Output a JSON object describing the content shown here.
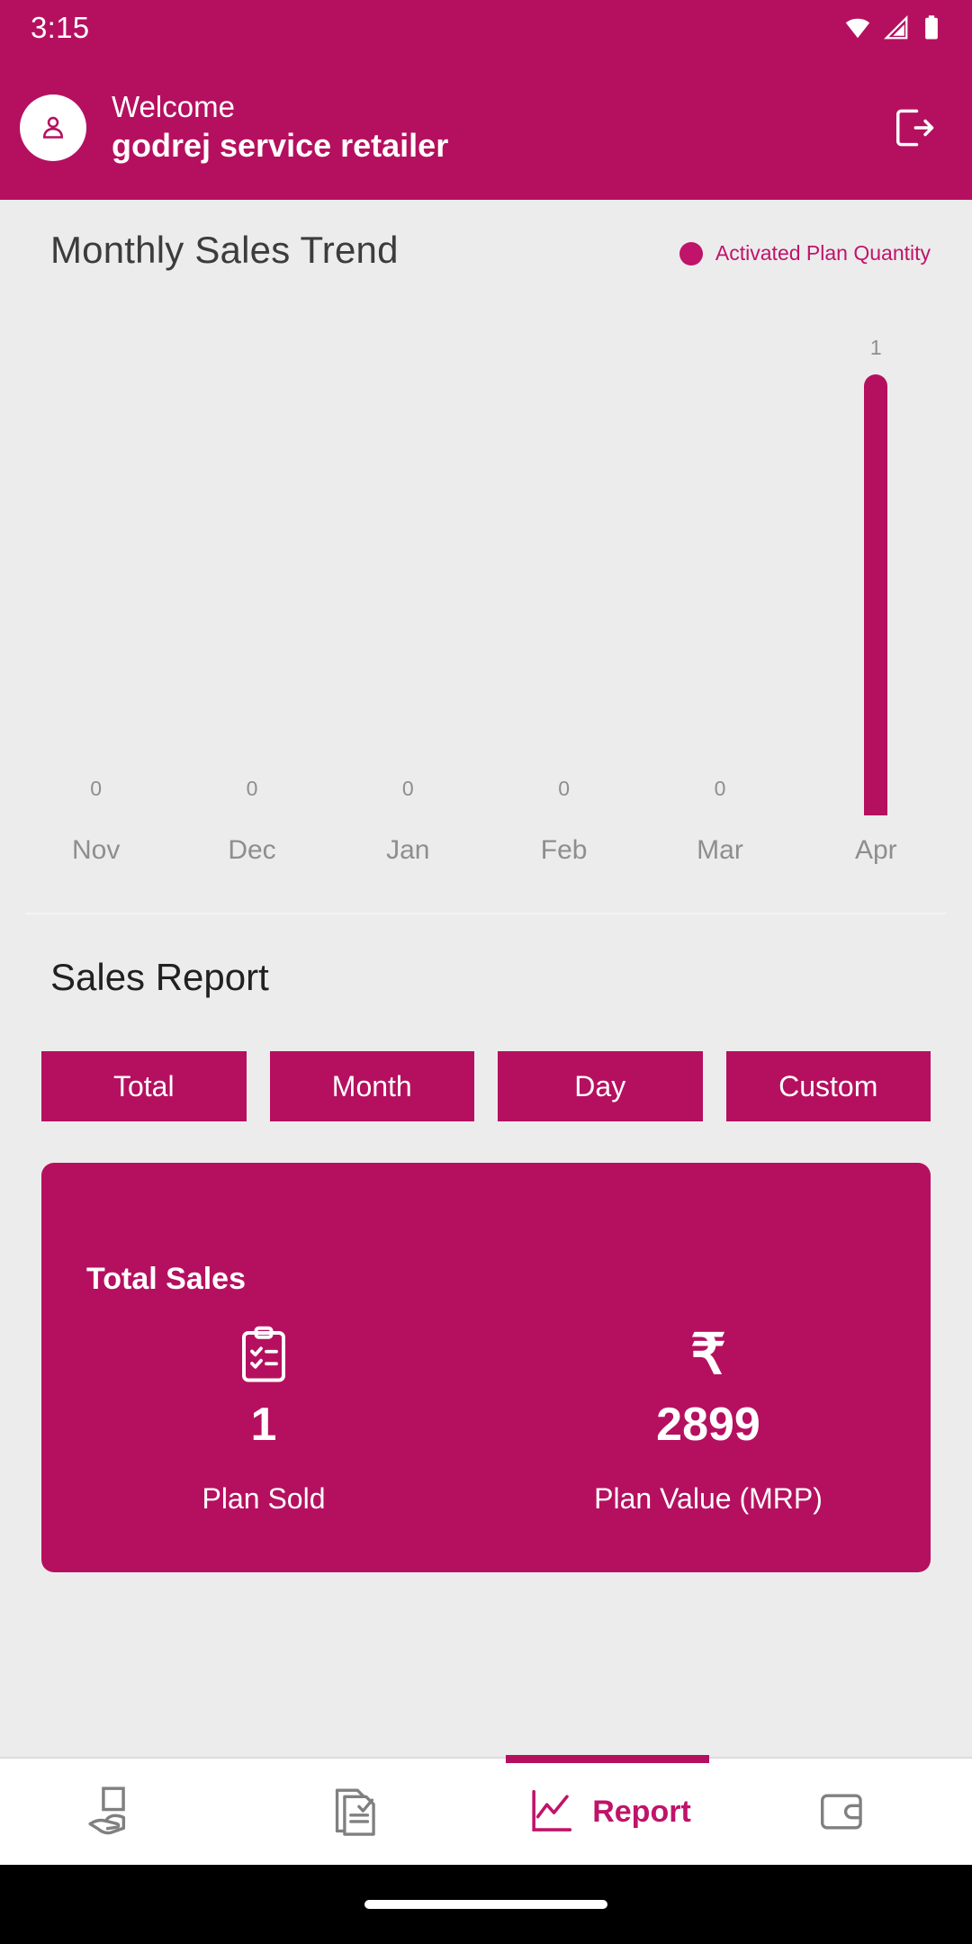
{
  "status_bar": {
    "time": "3:15",
    "icons": [
      "wifi-icon",
      "signal-icon",
      "battery-icon"
    ]
  },
  "app_bar": {
    "avatar_icon": "person-icon",
    "welcome_label": "Welcome",
    "user_name": "godrej service retailer",
    "logout_icon": "logout-icon"
  },
  "chart_section": {
    "title": "Monthly Sales Trend",
    "legend_label": "Activated Plan Quantity",
    "legend_color": "#c0136a"
  },
  "chart_data": {
    "type": "bar",
    "title": "Monthly Sales Trend",
    "categories": [
      "Nov",
      "Dec",
      "Jan",
      "Feb",
      "Mar",
      "Apr"
    ],
    "values": [
      0,
      0,
      0,
      0,
      0,
      1
    ],
    "series": [
      {
        "name": "Activated Plan Quantity",
        "values": [
          0,
          0,
          0,
          0,
          0,
          1
        ],
        "color": "#b5105f"
      }
    ],
    "xlabel": "",
    "ylabel": "",
    "ylim": [
      0,
      1
    ],
    "grid": false,
    "legend_position": "top-right",
    "data_labels": [
      "0",
      "0",
      "0",
      "0",
      "0",
      "1"
    ]
  },
  "report_section": {
    "title": "Sales Report",
    "tabs": [
      {
        "label": "Total",
        "selected": true
      },
      {
        "label": "Month",
        "selected": false
      },
      {
        "label": "Day",
        "selected": false
      },
      {
        "label": "Custom",
        "selected": false
      }
    ],
    "card": {
      "title": "Total Sales",
      "accent_color": "#b5105f",
      "metrics": [
        {
          "icon": "clipboard-checklist-icon",
          "value": "1",
          "label": "Plan Sold"
        },
        {
          "icon": "rupee-icon",
          "symbol": "₹",
          "value": "2899",
          "label": "Plan Value (MRP)"
        }
      ]
    }
  },
  "bottom_nav": {
    "items": [
      {
        "icon": "hand-holding-card-icon",
        "label": "",
        "active": false
      },
      {
        "icon": "document-check-icon",
        "label": "",
        "active": false
      },
      {
        "icon": "chart-line-icon",
        "label": "Report",
        "active": true
      },
      {
        "icon": "wallet-icon",
        "label": "",
        "active": false
      }
    ]
  }
}
